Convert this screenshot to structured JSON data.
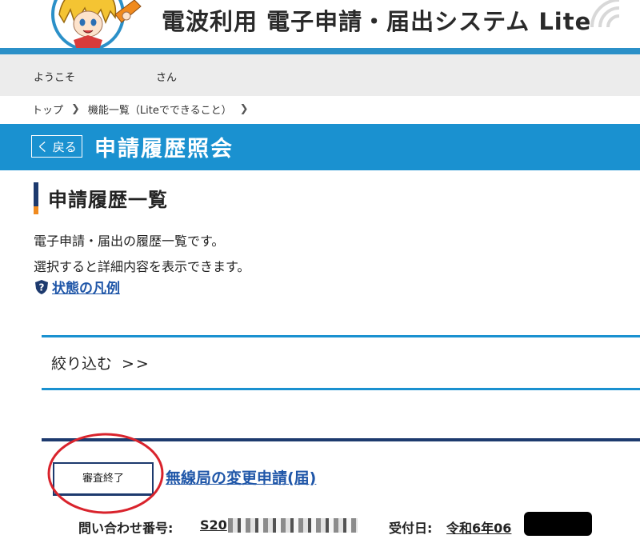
{
  "header": {
    "system_title": "電波利用 電子申請・届出システム Lite"
  },
  "welcome": {
    "prefix": "ようこそ",
    "user_name": "",
    "suffix": "さん"
  },
  "breadcrumb": {
    "items": [
      "トップ",
      "機能一覧（Liteでできること）"
    ],
    "separator": "❯"
  },
  "title_bar": {
    "back_label": "く 戻る",
    "page_title": "申請履歴照会"
  },
  "section": {
    "heading": "申請履歴一覧",
    "description_lines": [
      "電子申請・届出の履歴一覧です。",
      "選択すると詳細内容を表示できます。"
    ],
    "legend_link": "状態の凡例"
  },
  "filter": {
    "label": "絞り込む",
    "arrows": ">>"
  },
  "application": {
    "status": "審査終了",
    "title": "無線局の変更申請(届)",
    "inquiry_label": "問い合わせ番号:",
    "inquiry_value": "S20",
    "received_label": "受付日:",
    "received_value": "令和6年06"
  },
  "colors": {
    "accent_blue": "#1a91d0",
    "navy": "#1d3a6e",
    "orange": "#f08a1e",
    "link": "#1f56a8",
    "annotation_red": "#d9232c"
  },
  "icons": {
    "mascot": "mascot-character",
    "wifi": "wifi-arcs-icon",
    "legend": "shield-help-icon"
  }
}
